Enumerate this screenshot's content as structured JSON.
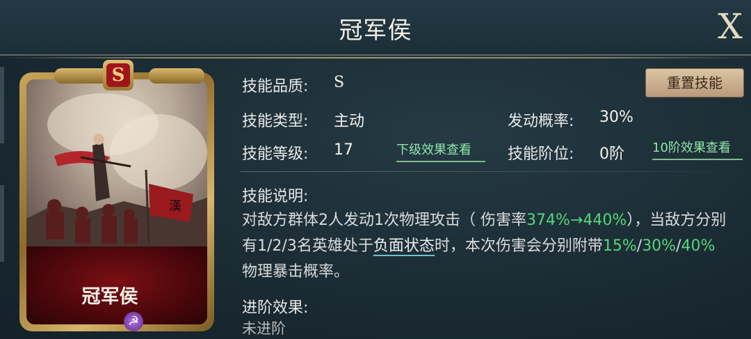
{
  "header": {
    "title": "冠军侯",
    "close_label": "X"
  },
  "card": {
    "grade": "S",
    "name": "冠军侯",
    "skill_icon": "crescent-hammer-icon"
  },
  "info": {
    "quality_label": "技能品质:",
    "quality_value": "S",
    "type_label": "技能类型:",
    "type_value": "主动",
    "trigger_label": "发动概率:",
    "trigger_value": "30%",
    "level_label": "技能等级:",
    "level_value": "17",
    "next_level_link": "下级效果查看",
    "rank_label": "技能阶位:",
    "rank_value": "0阶",
    "rank10_link": "10阶效果查看",
    "reset_button": "重置技能"
  },
  "description": {
    "label": "技能说明:",
    "part1": "对敌方群体2人发动1次物理攻击（ 伤害率",
    "dmg": "374%→440%",
    "part2": "），当敌方分别有1/2/3名英雄处于",
    "status": "负面状态",
    "part3": "时，本次伤害会分别附带",
    "crit1": "15%",
    "sep1": "/",
    "crit2": "30%",
    "sep2": "/",
    "crit3": "40%",
    "part4": "物理暴击概率。"
  },
  "advance": {
    "label": "进阶效果:",
    "value": "未进阶"
  },
  "colors": {
    "accent_green": "#56d77a",
    "reset_bg": "#d2b896",
    "card_red": "#7a0f14"
  }
}
